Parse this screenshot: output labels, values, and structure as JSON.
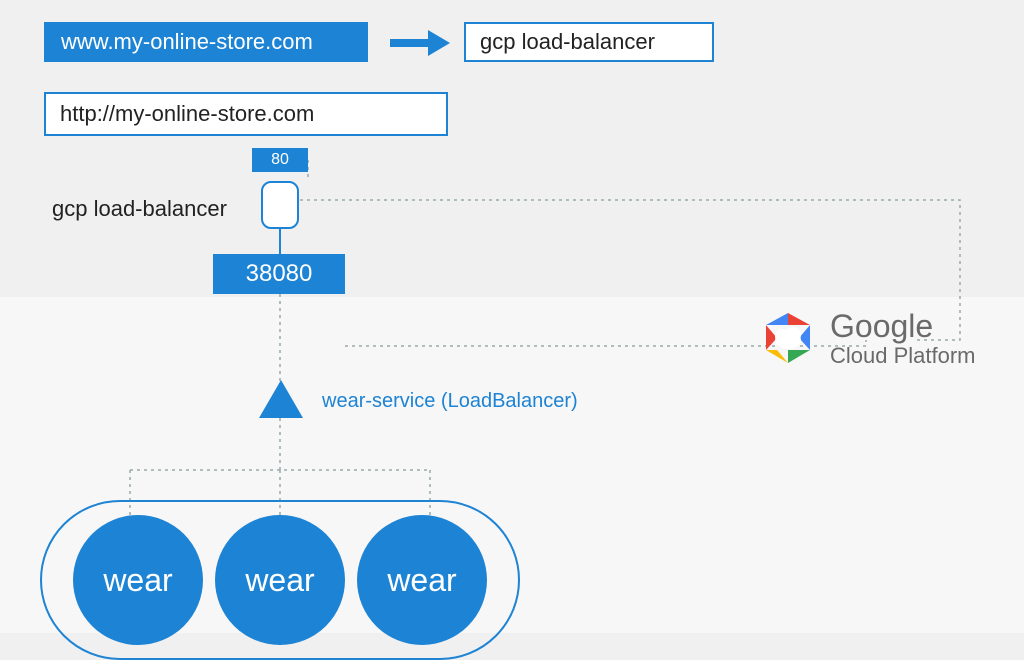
{
  "domain": {
    "name": "www.my-online-store.com"
  },
  "externalLB": {
    "label_top": "gcp load-balancer"
  },
  "url": {
    "value": "http://my-online-store.com"
  },
  "ports": {
    "external": "80",
    "node": "38080"
  },
  "lb_node": {
    "label": "gcp load-balancer"
  },
  "service": {
    "label": "wear-service (LoadBalancer)"
  },
  "pods": {
    "items": [
      "wear",
      "wear",
      "wear"
    ]
  },
  "cloud": {
    "name": "Google",
    "product": "Cloud Platform"
  }
}
